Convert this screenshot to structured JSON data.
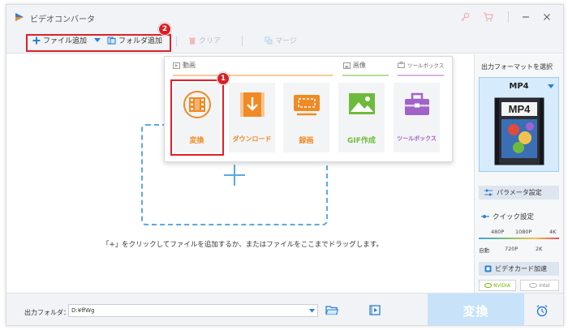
{
  "app": {
    "title": "ビデオコンバータ"
  },
  "toolbar": {
    "add_file_label": "ファイル追加",
    "add_folder_label": "フォルダ追加",
    "clear_label": "クリア",
    "merge_label": "マージ"
  },
  "popup": {
    "categories": {
      "video": "動画",
      "image": "画像",
      "toolbox": "ツールボックス"
    },
    "tiles": [
      {
        "label": "変換",
        "color": "#f08a24"
      },
      {
        "label": "ダウンロード",
        "color": "#f08a24"
      },
      {
        "label": "録画",
        "color": "#f08a24"
      },
      {
        "label": "GIF作成",
        "color": "#6dbb3c"
      },
      {
        "label": "ツールボックス",
        "color": "#a064c8"
      }
    ]
  },
  "main": {
    "hint": "「+」をクリックしてファイルを追加するか、またはファイルをここまでドラッグします。"
  },
  "badges": {
    "one": "1",
    "two": "2"
  },
  "panel": {
    "title": "出力フォーマットを選択",
    "format": "MP4",
    "format_thumb_text": "MP4",
    "param_label": "パラメータ設定",
    "quick_label": "クイック設定",
    "res_top": [
      "480P",
      "1080P",
      "4K"
    ],
    "res_bottom": [
      "自動",
      "720P",
      "2K"
    ],
    "gpu_label": "ビデオカード加速",
    "vendor_nvidia": "NVIDIA",
    "vendor_intel": "Intel"
  },
  "bottom": {
    "output_label": "出力フォルダ：",
    "output_path": "D:¥ffWg",
    "convert_label": "変換"
  },
  "colors": {
    "accent": "#2a7fd4",
    "highlight": "#e0202a",
    "orange": "#f08a24"
  }
}
